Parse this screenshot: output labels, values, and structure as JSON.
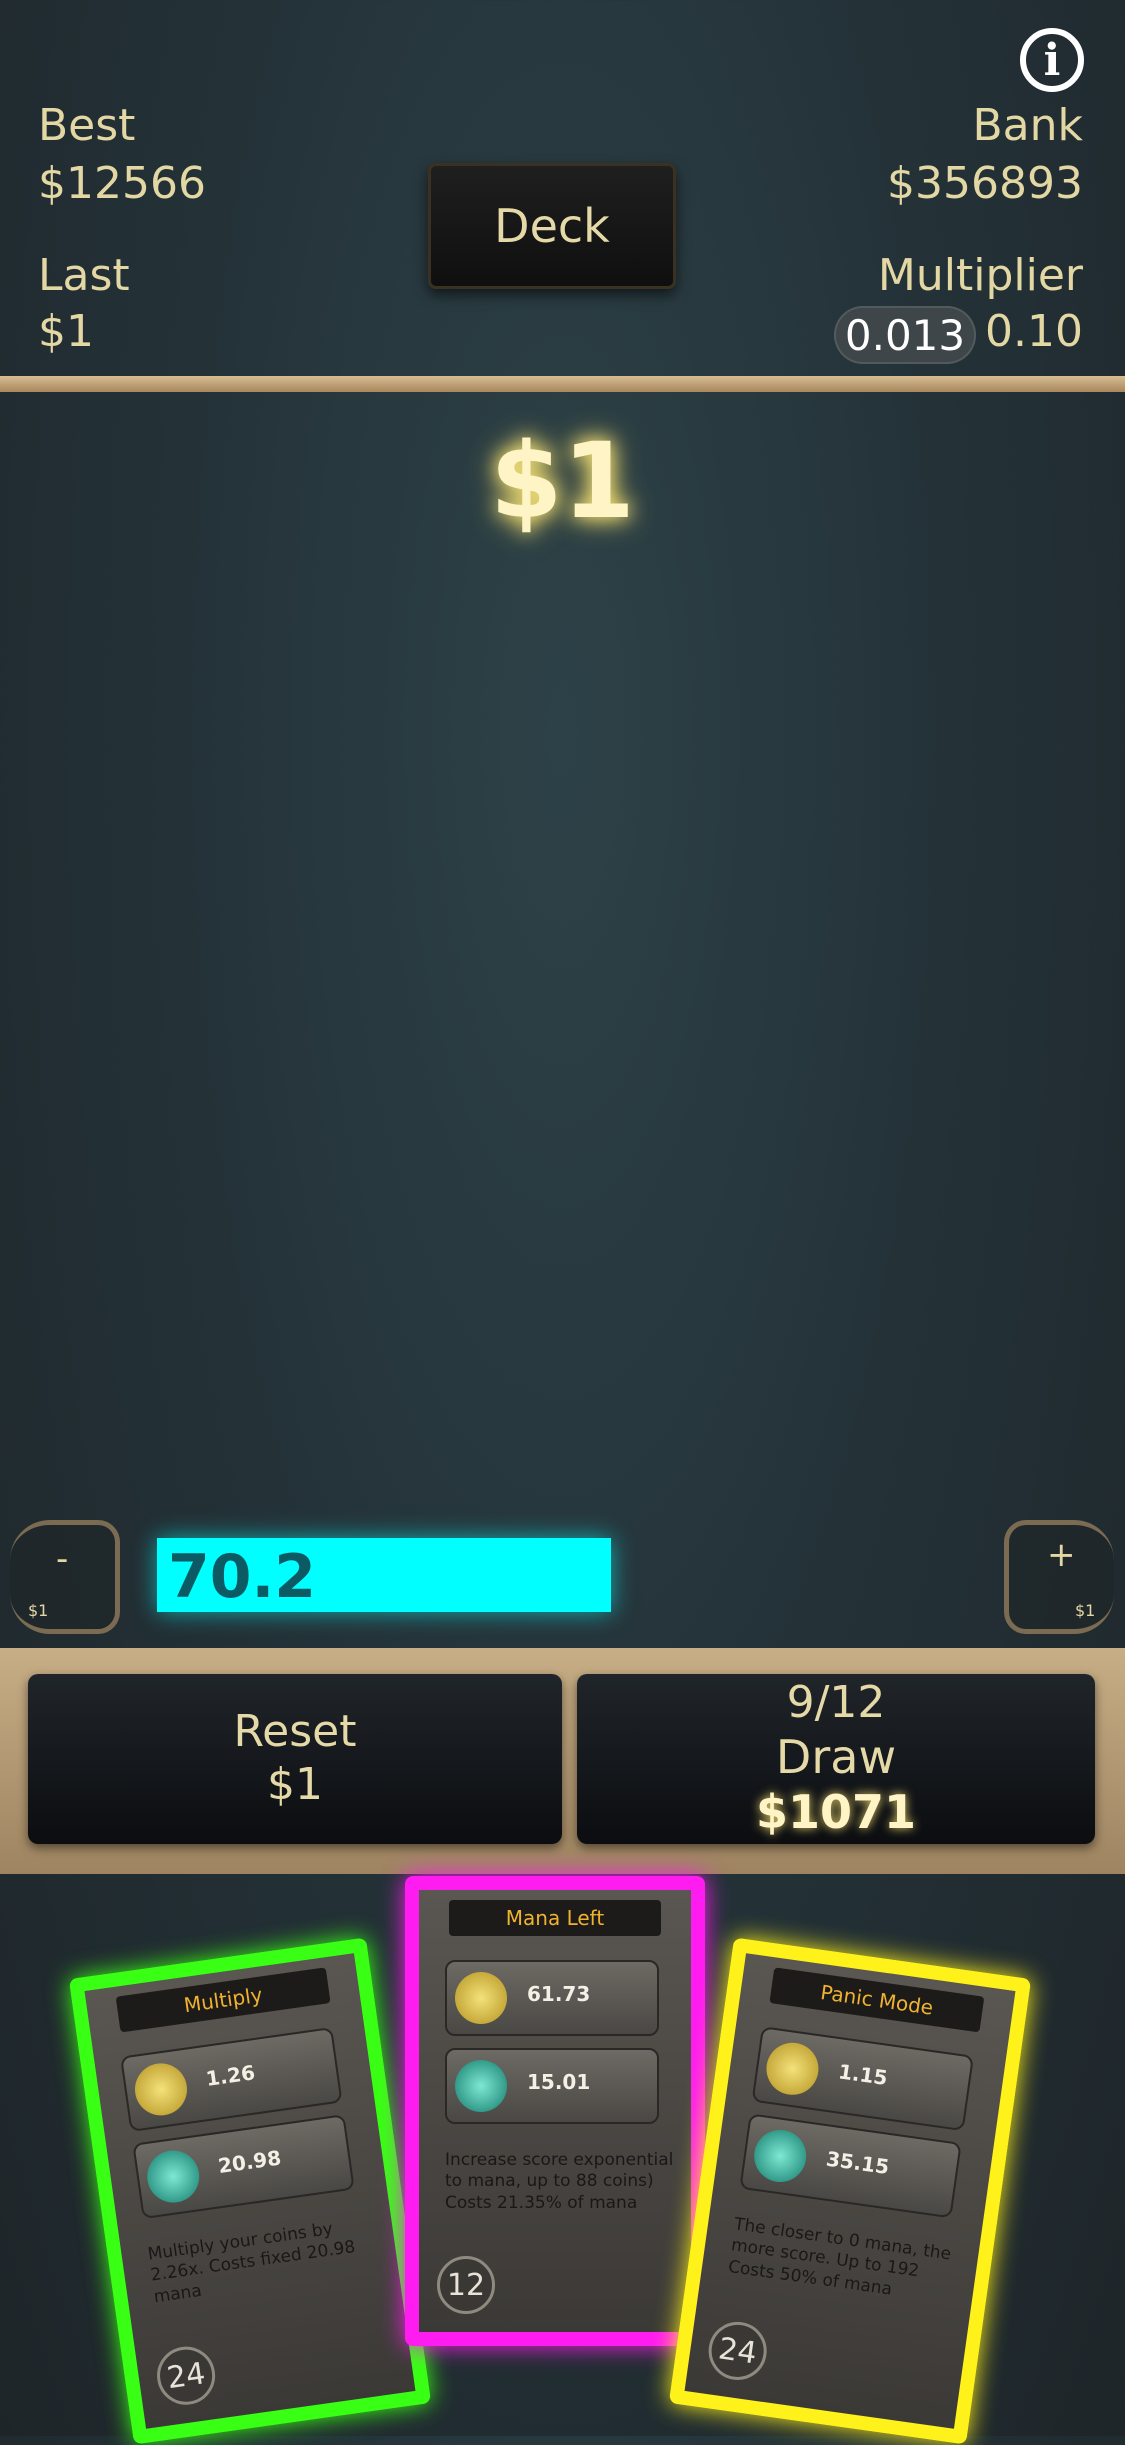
{
  "header": {
    "best_label": "Best",
    "best_value": "$12566",
    "last_label": "Last",
    "last_value": "$1",
    "bank_label": "Bank",
    "bank_value": "$356893",
    "multiplier_label": "Multiplier",
    "multiplier_current": "0.013",
    "multiplier_value": "0.10",
    "deck_label": "Deck",
    "info_icon": "i"
  },
  "score": "$1",
  "mana": {
    "value": "70.2",
    "fill_fraction": 0.585,
    "minus_symbol": "-",
    "minus_cost": "$1",
    "plus_symbol": "+",
    "plus_cost": "$1",
    "bar_color": "#00ffff"
  },
  "actions": {
    "reset_label": "Reset",
    "reset_cost": "$1",
    "draw_count": "9/12",
    "draw_label": "Draw",
    "draw_cost": "$1071"
  },
  "cards": [
    {
      "title": "Multiply",
      "coin_value": "1.26",
      "mana_value": "20.98",
      "description": "Multiply your coins by 2.26x. Costs fixed 20.98 mana",
      "level": "24",
      "border_color": "#39ff14"
    },
    {
      "title": "Mana Left",
      "coin_value": "61.73",
      "mana_value": "15.01",
      "description": "Increase score exponential to mana, up to 88 coins) Costs 21.35% of mana",
      "level": "12",
      "border_color": "#ff1cf0"
    },
    {
      "title": "Panic Mode",
      "coin_value": "1.15",
      "mana_value": "35.15",
      "description": "The closer to 0 mana, the more score. Up to 192 Costs 50% of mana",
      "level": "24",
      "border_color": "#fff21a"
    }
  ]
}
